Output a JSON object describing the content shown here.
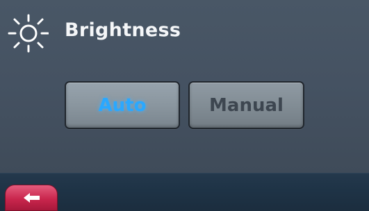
{
  "header": {
    "title": "Brightness",
    "icon": "sun-icon"
  },
  "mode_buttons": {
    "auto_label": "Auto",
    "manual_label": "Manual",
    "selected": "Auto"
  },
  "footer": {
    "back_icon": "back-arrow-icon"
  },
  "colors": {
    "background": "#455262",
    "selected_text": "#2aa8ff",
    "unselected_text": "#3d4650",
    "back_button": "#c9264d",
    "footer": "#1f3447"
  }
}
